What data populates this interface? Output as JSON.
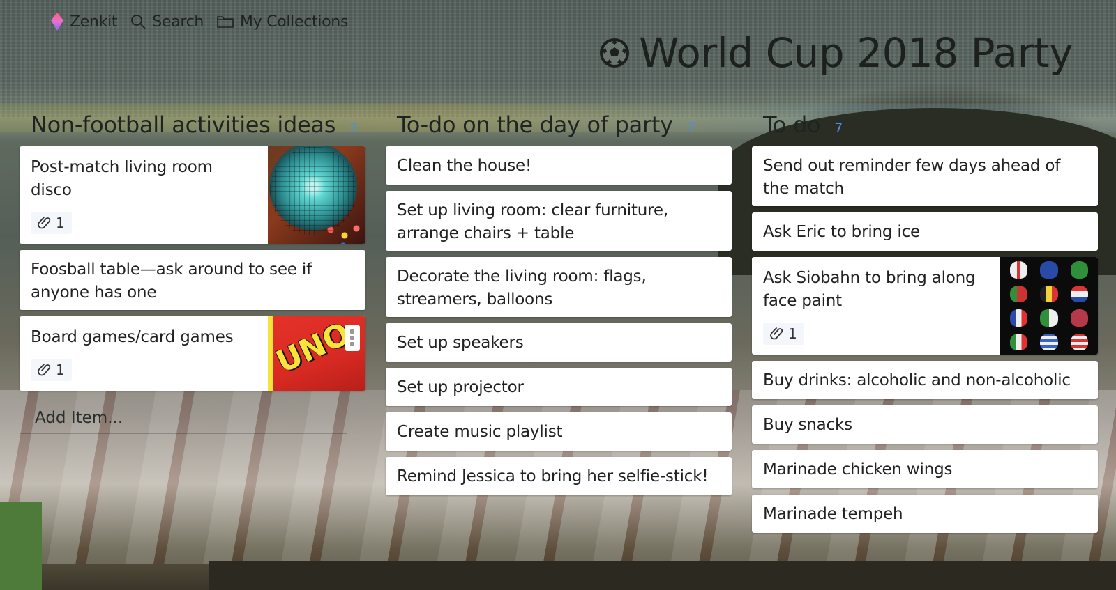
{
  "nav": {
    "menu_icon": "hamburger-icon",
    "brand": "Zenkit",
    "brand_icon": "zenkit-gem-icon",
    "search_label": "Search",
    "search_icon": "search-icon",
    "collections_label": "My Collections",
    "collections_icon": "folder-icon"
  },
  "page": {
    "title": "World Cup 2018 Party",
    "title_icon": "soccer-ball-icon"
  },
  "columns": [
    {
      "title": "Non-football activities ideas",
      "count": "3",
      "add_item_placeholder": "Add Item...",
      "cards": [
        {
          "text": "Post-match living room disco",
          "attachments": "1",
          "thumbnail": "disco-ball-image"
        },
        {
          "text": "Foosball table—ask around to see if anyone has one"
        },
        {
          "text": "Board games/card games",
          "attachments": "1",
          "thumbnail": "uno-cards-image",
          "menu_icon": "more-vertical-icon"
        }
      ]
    },
    {
      "title": "To-do on the day of party",
      "count": "7",
      "cards": [
        {
          "text": "Clean the house!"
        },
        {
          "text": "Set up living room: clear furniture, arrange chairs + table"
        },
        {
          "text": "Decorate the living room: flags, streamers, balloons"
        },
        {
          "text": "Set up speakers"
        },
        {
          "text": "Set up projector"
        },
        {
          "text": "Create music playlist"
        },
        {
          "text": "Remind Jessica to bring her selfie-stick!"
        }
      ]
    },
    {
      "title": "To do",
      "count": "7",
      "cards": [
        {
          "text": "Send out reminder few days ahead of the match"
        },
        {
          "text": "Ask Eric to bring ice"
        },
        {
          "text": "Ask Siobahn to bring along face paint",
          "attachments": "1",
          "thumbnail": "face-paint-flags-image"
        },
        {
          "text": "Buy drinks: alcoholic and non-alcoholic"
        },
        {
          "text": "Buy snacks"
        },
        {
          "text": "Marinade chicken wings"
        },
        {
          "text": "Marinade tempeh"
        }
      ]
    }
  ],
  "colors": {
    "count_accent": "#4a8fe0",
    "card_bg": "#ffffff",
    "text": "#222222"
  }
}
